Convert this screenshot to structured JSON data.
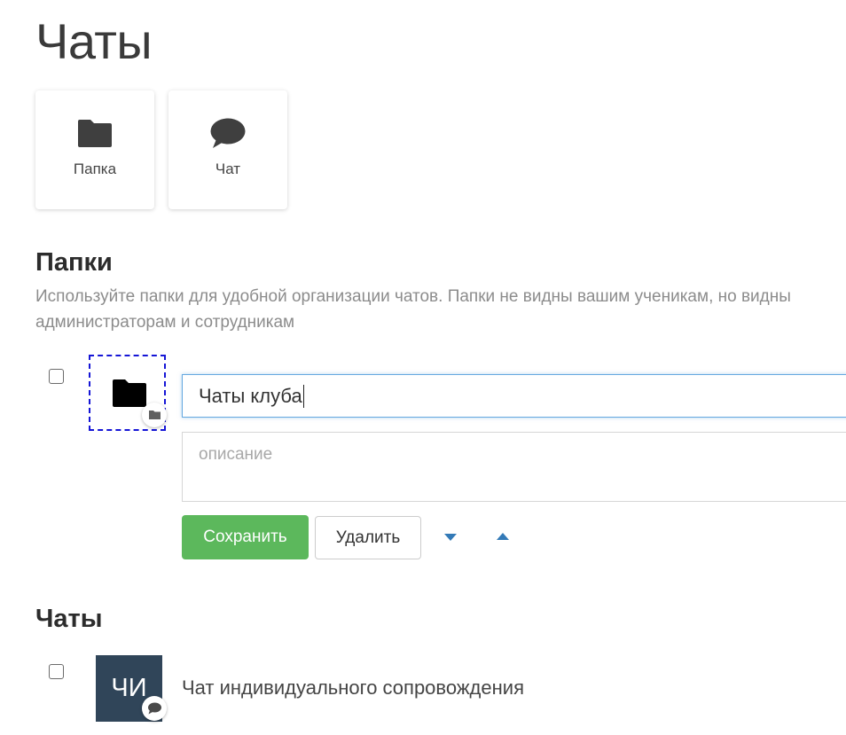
{
  "page": {
    "title": "Чаты"
  },
  "create_tiles": [
    {
      "label": "Папка",
      "icon": "folder-icon"
    },
    {
      "label": "Чат",
      "icon": "chat-bubble-icon"
    }
  ],
  "folders_section": {
    "title": "Папки",
    "description": "Используйте папки для удобной организации чатов. Папки не видны вашим ученикам, но видны администраторам и сотрудникам"
  },
  "folder_editor": {
    "checked": false,
    "icon": "folder-icon",
    "badge_icon": "folder-icon",
    "name_value": "Чаты клуба",
    "description_value": "",
    "description_placeholder": "описание",
    "save_label": "Сохранить",
    "delete_label": "Удалить",
    "move_down_icon": "caret-down-icon",
    "move_up_icon": "caret-up-icon"
  },
  "chats_section": {
    "title": "Чаты",
    "items": [
      {
        "checked": false,
        "avatar_initials": "ЧИ",
        "badge_icon": "chat-bubble-icon",
        "name": "Чат индивидуального сопровождения"
      }
    ]
  },
  "colors": {
    "save_button": "#5cb85c",
    "avatar_bg": "#304559",
    "arrow": "#337ab7",
    "focus_border": "#66a9e0",
    "selection_outline": "#1515d6"
  }
}
